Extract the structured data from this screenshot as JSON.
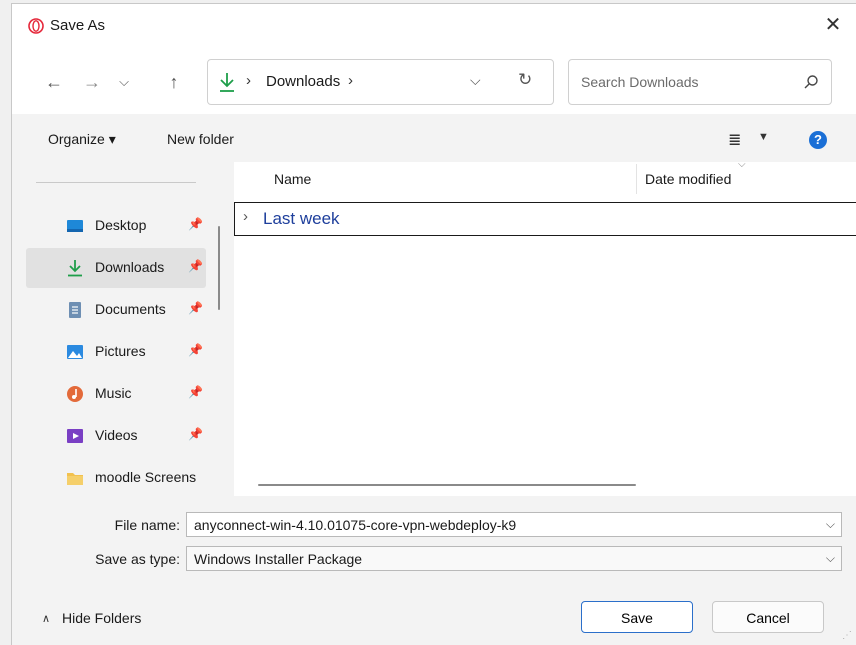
{
  "window": {
    "title": "Save As"
  },
  "nav": {
    "address_folder": "Downloads",
    "search_placeholder": "Search Downloads"
  },
  "toolbar": {
    "organize_label": "Organize ▾",
    "new_folder_label": "New folder"
  },
  "sidebar": {
    "items": [
      {
        "label": "Desktop",
        "icon": "desktop-icon",
        "pinned": true
      },
      {
        "label": "Downloads",
        "icon": "download-icon",
        "pinned": true,
        "selected": true
      },
      {
        "label": "Documents",
        "icon": "document-icon",
        "pinned": true
      },
      {
        "label": "Pictures",
        "icon": "pictures-icon",
        "pinned": true
      },
      {
        "label": "Music",
        "icon": "music-icon",
        "pinned": true
      },
      {
        "label": "Videos",
        "icon": "videos-icon",
        "pinned": true
      },
      {
        "label": "moodle Screens",
        "icon": "folder-icon",
        "pinned": false
      }
    ]
  },
  "file_list": {
    "columns": [
      "Name",
      "Date modified"
    ],
    "groups": [
      {
        "label": "Last week"
      }
    ]
  },
  "form": {
    "file_name_label": "File name:",
    "file_name_value": "anyconnect-win-4.10.01075-core-vpn-webdeploy-k9",
    "save_type_label": "Save as type:",
    "save_type_value": "Windows Installer Package"
  },
  "footer": {
    "hide_folders_label": "Hide Folders",
    "save_label": "Save",
    "cancel_label": "Cancel"
  },
  "colors": {
    "accent": "#1a6fd6",
    "download_green": "#1e9e4a",
    "group_label": "#1e3f9c"
  }
}
